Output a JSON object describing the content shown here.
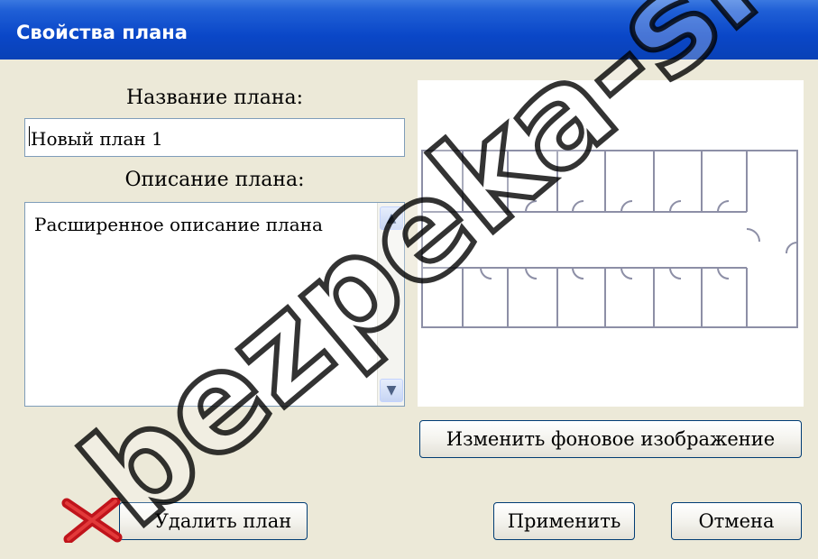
{
  "window": {
    "title": "Свойства плана"
  },
  "plan_name": {
    "label": "Название плана:",
    "value": "Новый план 1"
  },
  "plan_description": {
    "label": "Описание  плана:",
    "value": "Расширенное описание плана"
  },
  "preview": {
    "alt": "floor plan preview"
  },
  "buttons": {
    "change_background": "Изменить фоновое изображение",
    "delete_plan": "Удалить план",
    "apply": "Применить",
    "cancel": "Отмена"
  },
  "watermark": {
    "text": "bezpeka-shop"
  },
  "colors": {
    "titlebar": "#0a47c8",
    "dialog_bg": "#ece9d8",
    "delete_icon": "#c0141b"
  },
  "icons": {
    "delete": "red-x-icon",
    "scroll_up": "chevron-up-icon",
    "scroll_down": "chevron-down-icon"
  }
}
